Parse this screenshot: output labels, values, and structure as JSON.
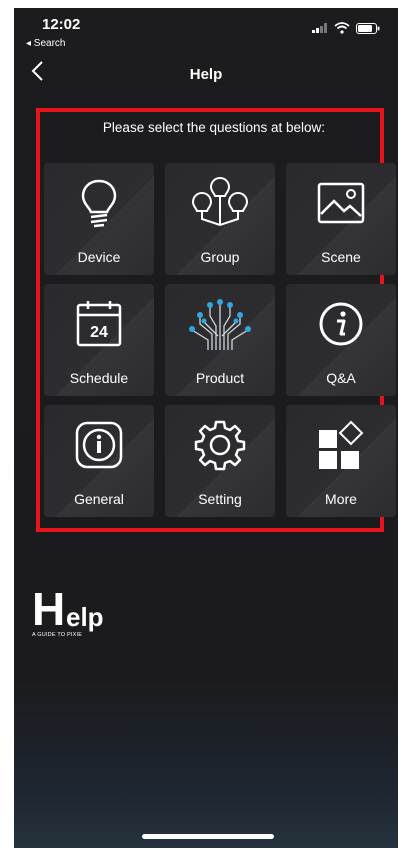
{
  "status": {
    "time": "12:02",
    "back_label": "◂ Search"
  },
  "nav": {
    "title": "Help"
  },
  "instruction": "Please select the questions at below:",
  "tiles": [
    {
      "label": "Device",
      "icon": "bulb-icon"
    },
    {
      "label": "Group",
      "icon": "bulb-group-icon"
    },
    {
      "label": "Scene",
      "icon": "image-icon"
    },
    {
      "label": "Schedule",
      "icon": "calendar-icon"
    },
    {
      "label": "Product",
      "icon": "circuit-tree-icon"
    },
    {
      "label": "Q&A",
      "icon": "info-circle-icon"
    },
    {
      "label": "General",
      "icon": "info-badge-icon"
    },
    {
      "label": "Setting",
      "icon": "gear-icon"
    },
    {
      "label": "More",
      "icon": "more-grid-icon"
    }
  ],
  "calendar_number": "24",
  "logo": {
    "big_letter": "H",
    "rest": "elp",
    "tagline": "A GUIDE TO PIXIE"
  },
  "colors": {
    "highlight": "#e8141b",
    "background": "#1c1c1e",
    "tile": "#2c2c2f",
    "accent_blue": "#2fa8e0"
  }
}
